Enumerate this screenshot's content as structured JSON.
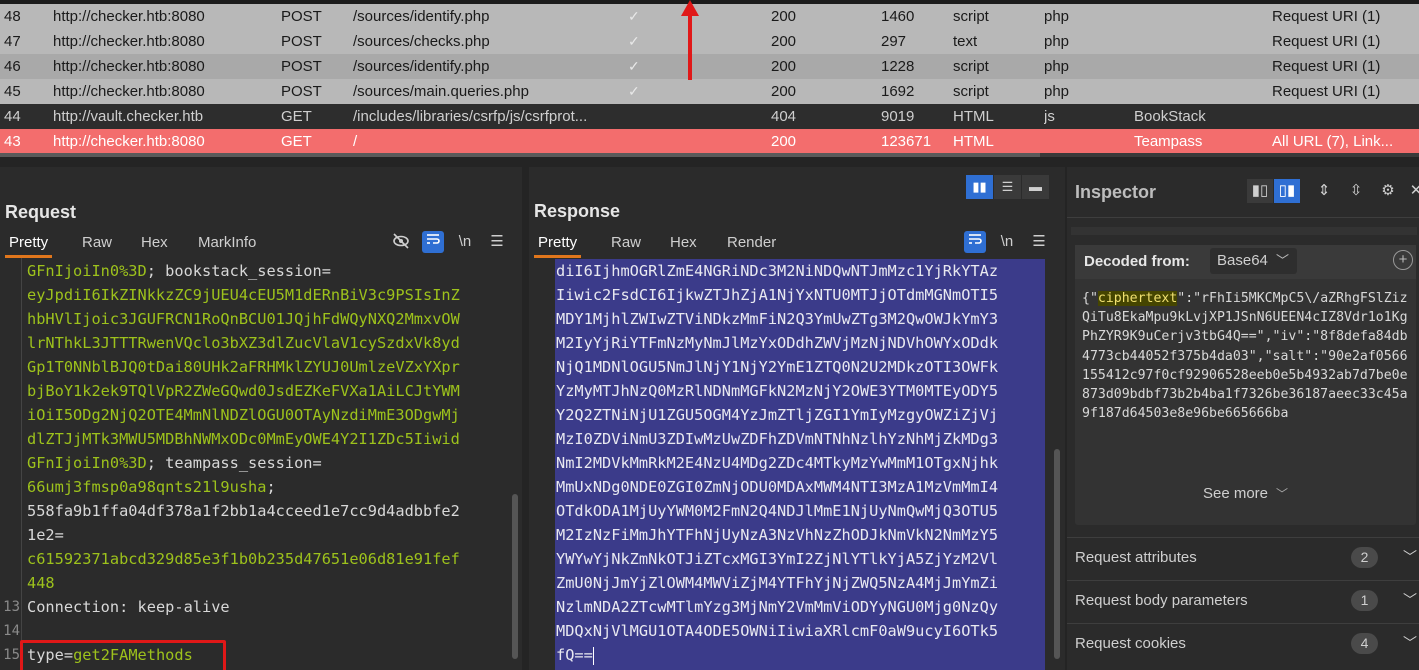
{
  "history": {
    "rows": [
      {
        "id": "48",
        "host": "http://checker.htb:8080",
        "method": "POST",
        "url": "/sources/identify.php",
        "check": "✓",
        "status": "200",
        "length": "1460",
        "mime": "script",
        "ext": "php",
        "title": "",
        "notes": "Request URI (1)",
        "style": "gray"
      },
      {
        "id": "47",
        "host": "http://checker.htb:8080",
        "method": "POST",
        "url": "/sources/checks.php",
        "check": "✓",
        "status": "200",
        "length": "297",
        "mime": "text",
        "ext": "php",
        "title": "",
        "notes": "Request URI (1)",
        "style": "gray"
      },
      {
        "id": "46",
        "host": "http://checker.htb:8080",
        "method": "POST",
        "url": "/sources/identify.php",
        "check": "✓",
        "status": "200",
        "length": "1228",
        "mime": "script",
        "ext": "php",
        "title": "",
        "notes": "Request URI (1)",
        "style": "gray sel"
      },
      {
        "id": "45",
        "host": "http://checker.htb:8080",
        "method": "POST",
        "url": "/sources/main.queries.php",
        "check": "✓",
        "status": "200",
        "length": "1692",
        "mime": "script",
        "ext": "php",
        "title": "",
        "notes": "Request URI (1)",
        "style": "gray"
      },
      {
        "id": "44",
        "host": "http://vault.checker.htb",
        "method": "GET",
        "url": "/includes/libraries/csrfp/js/csrfprot...",
        "check": "",
        "status": "404",
        "length": "9019",
        "mime": "HTML",
        "ext": "js",
        "title": "BookStack",
        "notes": "",
        "style": "dark"
      },
      {
        "id": "43",
        "host": "http://checker.htb:8080",
        "method": "GET",
        "url": "/",
        "check": "",
        "status": "200",
        "length": "123671",
        "mime": "HTML",
        "ext": "",
        "title": "Teampass",
        "notes": "All URL (7), Link...",
        "style": "red"
      }
    ]
  },
  "request": {
    "title": "Request",
    "tabs": [
      "Pretty",
      "Raw",
      "Hex",
      "MarkInfo"
    ],
    "newline_label": "\\n",
    "lines": [
      {
        "n": "",
        "parts": [
          {
            "t": "GFnIjoiIn0%3D",
            "c": "g"
          },
          {
            "t": "; bookstack_session=",
            "c": "w"
          }
        ]
      },
      {
        "n": "",
        "parts": [
          {
            "t": "eyJpdiI6IkZINkkzZC9jUEU4cEU5M1dERnBiV3c9PSIsInZ",
            "c": "g"
          }
        ]
      },
      {
        "n": "",
        "parts": [
          {
            "t": "hbHVlIjoic3JGUFRCN1RoQnBCU01JQjhFdWQyNXQ2MmxvOW",
            "c": "g"
          }
        ]
      },
      {
        "n": "",
        "parts": [
          {
            "t": "lrNThkL3JTTTRwenVQclo3bXZ3dlZucVlaV1cySzdxVk8yd",
            "c": "g"
          }
        ]
      },
      {
        "n": "",
        "parts": [
          {
            "t": "Gp1T0NNblBJQ0tDai80UHk2aFRHMklZYUJ0UmlzeVZxYXpr",
            "c": "g"
          }
        ]
      },
      {
        "n": "",
        "parts": [
          {
            "t": "bjBoY1k2ek9TQlVpR2ZWeGQwd0JsdEZKeFVXa1AiLCJtYWM",
            "c": "g"
          }
        ]
      },
      {
        "n": "",
        "parts": [
          {
            "t": "iOiI5ODg2NjQ2OTE4MmNlNDZlOGU0OTAyNzdiMmE3ODgwMj",
            "c": "g"
          }
        ]
      },
      {
        "n": "",
        "parts": [
          {
            "t": "dlZTJjMTk3MWU5MDBhNWMxODc0MmEyOWE4Y2I1ZDc5Iiwid",
            "c": "g"
          }
        ]
      },
      {
        "n": "",
        "parts": [
          {
            "t": "GFnIjoiIn0%3D",
            "c": "g"
          },
          {
            "t": "; teampass_session=",
            "c": "w"
          }
        ]
      },
      {
        "n": "",
        "parts": [
          {
            "t": "66umj3fmsp0a98qnts21l9usha",
            "c": "g"
          },
          {
            "t": ";",
            "c": "w"
          }
        ]
      },
      {
        "n": "",
        "parts": [
          {
            "t": "558fa9b1ffa04df378a1f2bb1a4cceed1e7cc9d4adbbfe2",
            "c": "w"
          }
        ]
      },
      {
        "n": "",
        "parts": [
          {
            "t": "1e2=",
            "c": "w"
          }
        ]
      },
      {
        "n": "",
        "parts": [
          {
            "t": "c61592371abcd329d85e3f1b0b235d47651e06d81e91fef",
            "c": "g"
          }
        ]
      },
      {
        "n": "",
        "parts": [
          {
            "t": "448",
            "c": "g"
          }
        ]
      },
      {
        "n": "13",
        "parts": [
          {
            "t": "Connection",
            "c": "w"
          },
          {
            "t": ": keep-alive",
            "c": "w"
          }
        ]
      },
      {
        "n": "14",
        "parts": []
      },
      {
        "n": "15",
        "parts": [
          {
            "t": "type",
            "c": "w"
          },
          {
            "t": "=",
            "c": "w"
          },
          {
            "t": "get2FAMethods",
            "c": "g"
          }
        ]
      }
    ]
  },
  "response": {
    "title": "Response",
    "tabs": [
      "Pretty",
      "Raw",
      "Hex",
      "Render"
    ],
    "newline_label": "\\n",
    "lines": [
      "diI6IjhmOGRlZmE4NGRiNDc3M2NiNDQwNTJmMzc1YjRkYTAz",
      "Iiwic2FsdCI6IjkwZTJhZjA1NjYxNTU0MTJjOTdmMGNmOTI5",
      "MDY1MjhlZWIwZTViNDkzMmFiN2Q3YmUwZTg3M2QwOWJkYmY3",
      "M2IyYjRiYTFmNzMyNmJlMzYxODdhZWVjMzNjNDVhOWYxODdk",
      "NjQ1MDNlOGU5NmJlNjY1NjY2YmE1ZTQ0N2U2MDkzOTI3OWFk",
      "YzMyMTJhNzQ0MzRlNDNmMGFkN2MzNjY2OWE3YTM0MTEyODY5",
      "Y2Q2ZTNiNjU1ZGU5OGM4YzJmZTljZGI1YmIyMzgyOWZiZjVj",
      "MzI0ZDViNmU3ZDIwMzUwZDFhZDVmNTNhNzlhYzNhMjZkMDg3",
      "NmI2MDVkMmRkM2E4NzU4MDg2ZDc4MTkyMzYwMmM1OTgxNjhk",
      "MmUxNDg0NDE0ZGI0ZmNjODU0MDAxMWM4NTI3MzA1MzVmMmI4",
      "OTdkODA1MjUyYWM0M2FmN2Q4NDJlMmE1NjUyNmQwMjQ3OTU5",
      "M2IzNzFiMmJhYTFhNjUyNzA3NzVhNzZhODJkNmVkN2NmMzY5",
      "YWYwYjNkZmNkOTJiZTcxMGI3YmI2ZjNlYTlkYjA5ZjYzM2Vl",
      "ZmU0NjJmYjZlOWM4MWViZjM4YTFhYjNjZWQ5NzA4MjJmYmZi",
      "NzlmNDA2ZTcwMTlmYzg3MjNmY2VmMmViODYyNGU0Mjg0NzQy",
      "MDQxNjVlMGU1OTA4ODE5OWNiIiwiaXRlcmF0aW9ucyI6OTk5",
      "fQ=="
    ]
  },
  "inspector": {
    "title": "Inspector",
    "decoded_from_label": "Decoded from:",
    "decoded_from_value": "Base64",
    "decoded": {
      "open": "{\"",
      "key": "ciphertext",
      "rest": "\":\"rFhIi5MKCMpC5\\/aZRhgFSlZizQiTu8EkaMpu9kLvjXP1JSnN6UEEN4cIZ8Vdr1o1KgPhZYR9K9uCerjv3tbG4Q==\",\"iv\":\"8f8defa84db4773cb44052f375b4da03\",\"salt\":\"90e2af0566155412c97f0cf92906528eeb0e5b4932ab7d7be0e873d09bdbf73b2b4ba1f7326be36187aeec33c45a9f187d64503e8e96be665666ba"
    },
    "see_more": "See more",
    "sections": [
      {
        "label": "Request attributes",
        "count": "2"
      },
      {
        "label": "Request body parameters",
        "count": "1"
      },
      {
        "label": "Request cookies",
        "count": "4"
      }
    ]
  }
}
